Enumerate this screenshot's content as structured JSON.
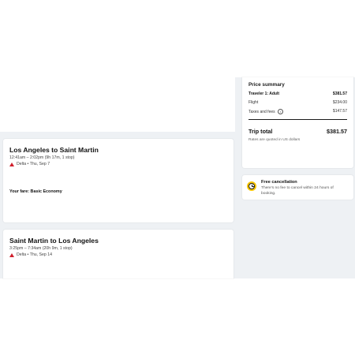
{
  "flights": [
    {
      "title": "Los Angeles to Saint Martin",
      "time": "12:41am – 2:02pm (9h 17m, 1 stop)",
      "carrier": "Delta • Thu, Sep 7",
      "fare": "Your fare: Basic Economy"
    },
    {
      "title": "Saint Martin to Los Angeles",
      "time": "3:25pm – 7:34am (20h 9m, 1 stop)",
      "carrier": "Delta • Thu, Sep 14"
    }
  ],
  "price_summary": {
    "title": "Price summary",
    "traveler_label": "Traveler 1: Adult",
    "traveler_total": "$381.57",
    "flight_label": "Flight",
    "flight_value": "$234.00",
    "taxes_label": "Taxes and fees",
    "taxes_value": "$147.57",
    "trip_total_label": "Trip total",
    "trip_total_value": "$381.57",
    "rates_note": "Rates are quoted in US dollars"
  },
  "free_cancellation": {
    "title": "Free cancellation",
    "text": "There's no fee to cancel within 24 hours of booking."
  },
  "colors": {
    "delta_red": "#d0202d",
    "clock_yellow": "#f7c500",
    "page_bg": "#eef1f4"
  }
}
